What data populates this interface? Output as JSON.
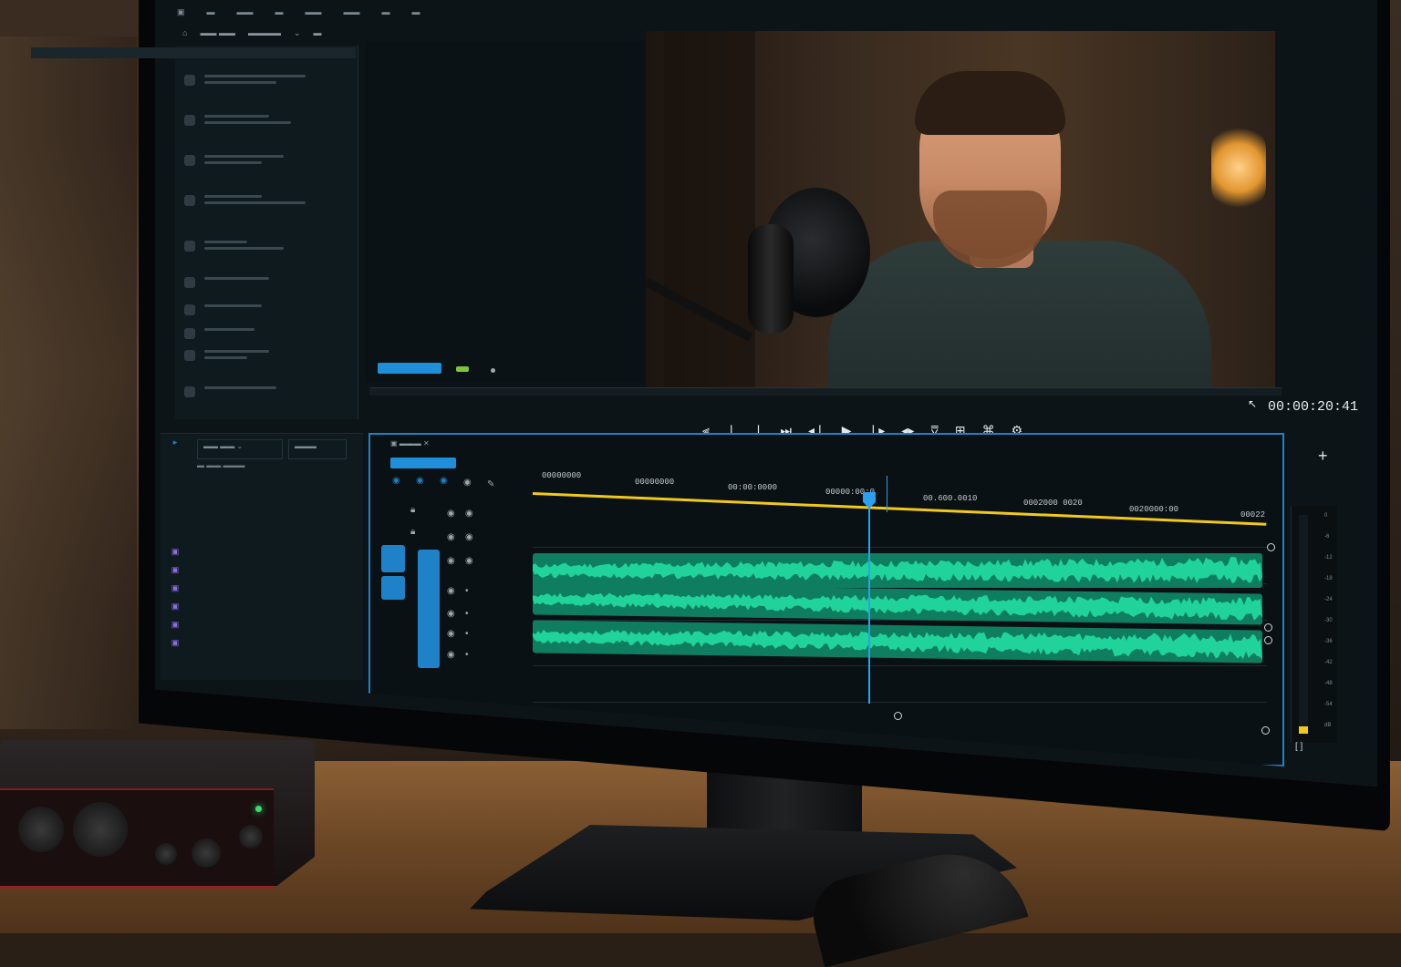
{
  "program_monitor": {
    "timecode": "00:00:20:41"
  },
  "timeline": {
    "ruler": [
      "00000000",
      "00000000",
      "00:00:0000",
      "00000:00:0",
      "00.600.0010",
      "0002000 0020",
      "0020000:00",
      "00022"
    ]
  },
  "transport_icons": [
    "mark-in-icon",
    "step-back-icon",
    "play-icon",
    "step-forward-icon",
    "mark-out-icon",
    "insert-icon",
    "overwrite-icon",
    "export-frame-icon",
    "settings-icon"
  ],
  "colors": {
    "accent": "#1f82c8",
    "waveform": "#1fd39a",
    "work_area": "#f2c91b",
    "led": "#35e06a"
  },
  "panels": {
    "plus_button": "+",
    "meter_scale": [
      "0",
      "-6",
      "-12",
      "-18",
      "-24",
      "-30",
      "-36",
      "-42",
      "-48",
      "-54",
      "dB"
    ]
  }
}
